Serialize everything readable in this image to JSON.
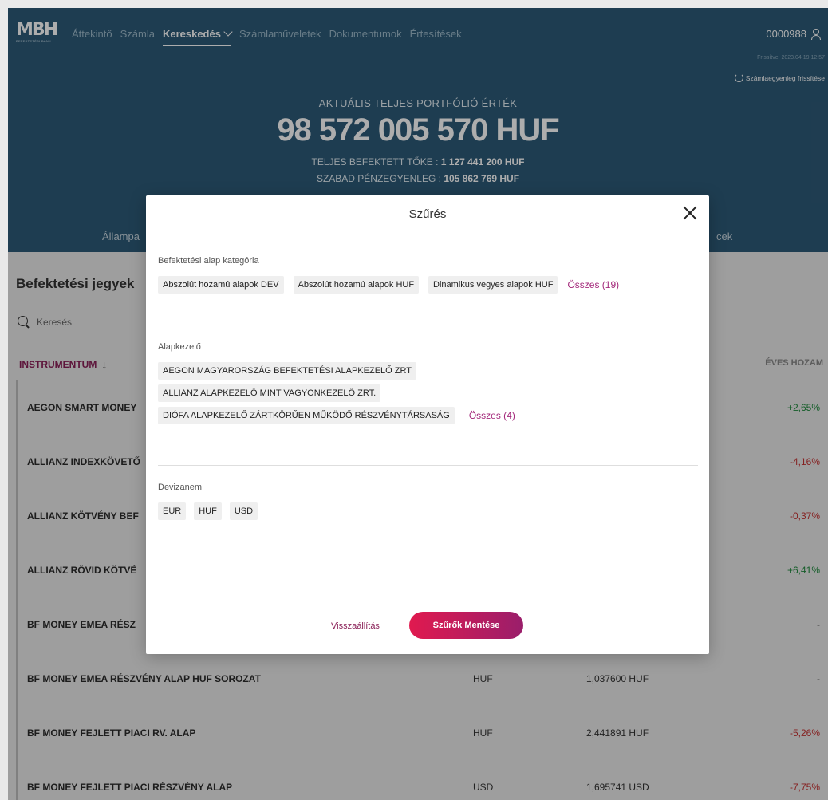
{
  "header": {
    "logo_text": "MBH",
    "logo_sub": "BEFEKTETÉSI BANK",
    "nav": [
      {
        "label": "Áttekintő",
        "active": false
      },
      {
        "label": "Számla",
        "active": false
      },
      {
        "label": "Kereskedés",
        "active": true
      },
      {
        "label": "Számlaműveletek",
        "active": false
      },
      {
        "label": "Dokumentumok",
        "active": false
      },
      {
        "label": "Értesítések",
        "active": false
      }
    ],
    "account_number": "0000988",
    "updated": "Frissítve: 2023.04.19 12:57",
    "refresh_label": "Számlaegyenleg frissítése"
  },
  "hero": {
    "label": "AKTUÁLIS TELJES PORTFÓLIÓ ÉRTÉK",
    "value": "98 572 005 570 HUF",
    "invested_label": "TELJES BEFEKTETT TŐKE :",
    "invested_value": "1 127 441 200 HUF",
    "cash_label": "SZABAD PÉNZEGYENLEG :",
    "cash_value": "105 862 769 HUF",
    "tab_left": "Állampa",
    "tab_right": "cek"
  },
  "page": {
    "section_title": "Befektetési jegyek",
    "search_placeholder": "Keresés",
    "col_instrument": "INSTRUMENTUM",
    "col_yield": "ÉVES HOZAM"
  },
  "rows": [
    {
      "name": "AEGON SMART MONEY",
      "currency": "",
      "price": "",
      "yield": "+2,65%",
      "sign": "pos"
    },
    {
      "name": "ALLIANZ INDEXKÖVETŐ",
      "currency": "",
      "price": "",
      "yield": "-4,16%",
      "sign": "neg"
    },
    {
      "name": "ALLIANZ KÖTVÉNY BEF",
      "currency": "",
      "price": "",
      "yield": "-0,37%",
      "sign": "neg"
    },
    {
      "name": "ALLIANZ RÖVID KÖTVÉ",
      "currency": "",
      "price": "",
      "yield": "+6,41%",
      "sign": "pos"
    },
    {
      "name": "BF MONEY EMEA RÉSZ",
      "currency": "",
      "price": "",
      "yield": "-",
      "sign": "neu"
    },
    {
      "name": "BF MONEY EMEA RÉSZVÉNY ALAP HUF SOROZAT",
      "currency": "HUF",
      "price": "1,037600 HUF",
      "yield": "-",
      "sign": "neu"
    },
    {
      "name": "BF MONEY FEJLETT PIACI RV. ALAP",
      "currency": "HUF",
      "price": "2,441891 HUF",
      "yield": "-5,26%",
      "sign": "neg"
    },
    {
      "name": "BF MONEY FEJLETT PIACI RÉSZVÉNY ALAP",
      "currency": "USD",
      "price": "1,695741 USD",
      "yield": "-7,75%",
      "sign": "neg"
    }
  ],
  "modal": {
    "title": "Szűrés",
    "category": {
      "label": "Befektetési alap kategória",
      "chips": [
        "Abszolút hozamú alapok DEV",
        "Abszolút hozamú alapok HUF",
        "Dinamikus vegyes alapok HUF"
      ],
      "all_link": "Összes (19)"
    },
    "manager": {
      "label": "Alapkezelő",
      "chips": [
        "AEGON MAGYARORSZÁG BEFEKTETÉSI ALAPKEZELŐ ZRT",
        "ALLIANZ ALAPKEZELŐ MINT VAGYONKEZELŐ ZRT.",
        "DIÓFA ALAPKEZELŐ ZÁRTKÖRŰEN MŰKÖDŐ RÉSZVÉNYTÁRSASÁG"
      ],
      "all_link": "Összes (4)"
    },
    "currency": {
      "label": "Devizanem",
      "chips": [
        "EUR",
        "HUF",
        "USD"
      ]
    },
    "reset_label": "Visszaállítás",
    "save_label": "Szűrők Mentése"
  }
}
